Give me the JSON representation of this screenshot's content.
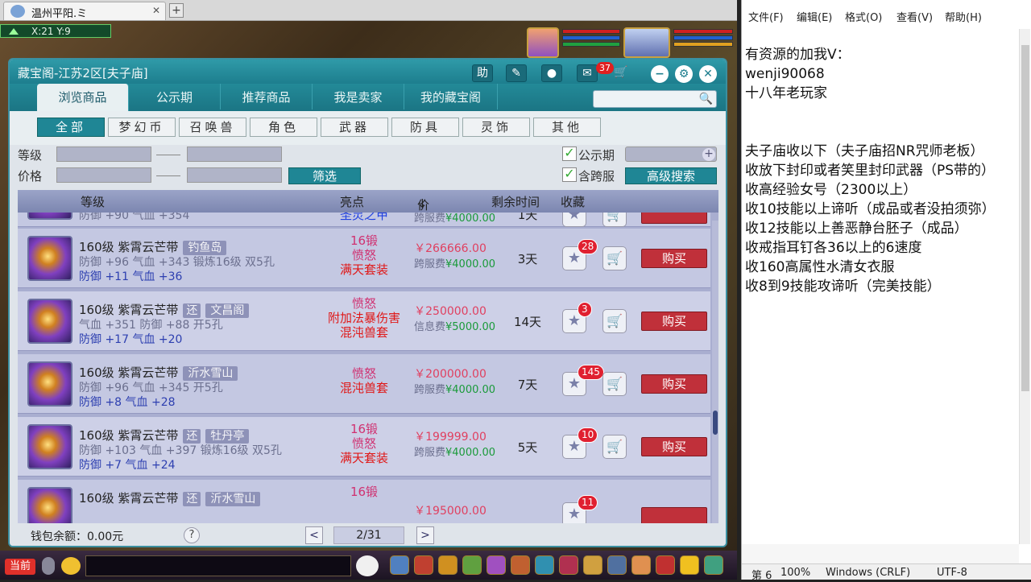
{
  "browser": {
    "tab_title": "温州平阳.ミ",
    "close": "✕",
    "new_tab": "+"
  },
  "hud": {
    "coords": "X:21 Y:9"
  },
  "window": {
    "title": "藏宝阁-江苏2区[夫子庙]",
    "header_buttons": {
      "help": "助",
      "message_badge": "37"
    },
    "tabs": [
      "浏览商品",
      "公示期",
      "推荐商品",
      "我是卖家",
      "我的藏宝阁"
    ],
    "categories": [
      "全部",
      "梦幻币",
      "召唤兽",
      "角色",
      "武器",
      "防具",
      "灵饰",
      "其他"
    ],
    "filters": {
      "level_label": "等级",
      "price_label": "价格",
      "filter_button": "筛选",
      "public_label": "公示期",
      "cross_label": "含跨服",
      "advanced_button": "高级搜索"
    },
    "columns": {
      "level": "等级",
      "highlight": "亮点",
      "price": "价钱",
      "price_sort": "↓",
      "time": "剩余时间",
      "fav": "收藏"
    },
    "partial_top": {
      "stat": "防御 +90 气血 +354",
      "highlight": "圣灵之甲",
      "fee_label": "跨服费",
      "fee": "¥4000.00",
      "time": "1天"
    },
    "rows": [
      {
        "name": "160级 紫霄云芒带",
        "tag": "钓鱼岛",
        "stat1": "防御 +96 气血 +343 锻炼16级 双5孔",
        "stat2": "防御 +11 气血 +36",
        "hl1": "16锻",
        "hl2": "愤怒",
        "hl3": "满天套装",
        "price": "￥266666.00",
        "fee_label": "跨服费",
        "fee": "¥4000.00",
        "time": "3天",
        "favs": "28",
        "buy": "购买"
      },
      {
        "name": "160级 紫霄云芒带",
        "tag_pre": "还",
        "tag": "文昌阁",
        "stat1": "气血 +351 防御 +88 开5孔",
        "stat2": "防御 +17 气血 +20",
        "hl1": "愤怒",
        "hl2": "附加法暴伤害",
        "hl3": "混沌兽套",
        "price": "￥250000.00",
        "fee_label": "信息费",
        "fee": "¥5000.00",
        "time": "14天",
        "favs": "3",
        "buy": "购买"
      },
      {
        "name": "160级 紫霄云芒带",
        "tag": "沂水雪山",
        "stat1": "防御 +96 气血 +345 开5孔",
        "stat2": "防御 +8 气血 +28",
        "hl1": "愤怒",
        "hl2": "混沌兽套",
        "price": "￥200000.00",
        "fee_label": "跨服费",
        "fee": "¥4000.00",
        "time": "7天",
        "favs": "145",
        "buy": "购买"
      },
      {
        "name": "160级 紫霄云芒带",
        "tag_pre": "还",
        "tag": "牡丹亭",
        "stat1": "防御 +103 气血 +397 锻炼16级 双5孔",
        "stat2": "防御 +7 气血 +24",
        "hl1": "16锻",
        "hl2": "愤怒",
        "hl3": "满天套装",
        "price": "￥199999.00",
        "fee_label": "跨服费",
        "fee": "¥4000.00",
        "time": "5天",
        "favs": "10",
        "buy": "购买"
      },
      {
        "name": "160级 紫霄云芒带",
        "tag_pre": "还",
        "tag": "沂水雪山",
        "hl1": "16锻",
        "price": "￥195000.00",
        "favs": "11"
      }
    ],
    "footer": {
      "balance": "钱包余额：0.00元",
      "help": "?",
      "page": "2/31",
      "prev": "<",
      "next": ">"
    }
  },
  "bottom": {
    "current": "当前"
  },
  "notepad": {
    "menu": [
      "文件(F)",
      "编辑(E)",
      "格式(O)",
      "查看(V)",
      "帮助(H)"
    ],
    "text": "有资源的加我V：\nwenji90068\n十八年老玩家\n\n\n夫子庙收以下（夫子庙招NR咒师老板）\n收放下封印或者笑里封印武器（PS带的）\n收高经验女号（2300以上）\n收10技能以上谛听（成品或者没拍须弥）\n收12技能以上善恶静台胚子（成品）\n收戒指耳钉各36以上的6速度\n收160高属性水清女衣服\n收8到9技能攻谛听（完美技能）",
    "status": {
      "line": "第 6",
      "zoom": "100%",
      "eol": "Windows (CRLF)",
      "enc": "UTF-8"
    }
  }
}
